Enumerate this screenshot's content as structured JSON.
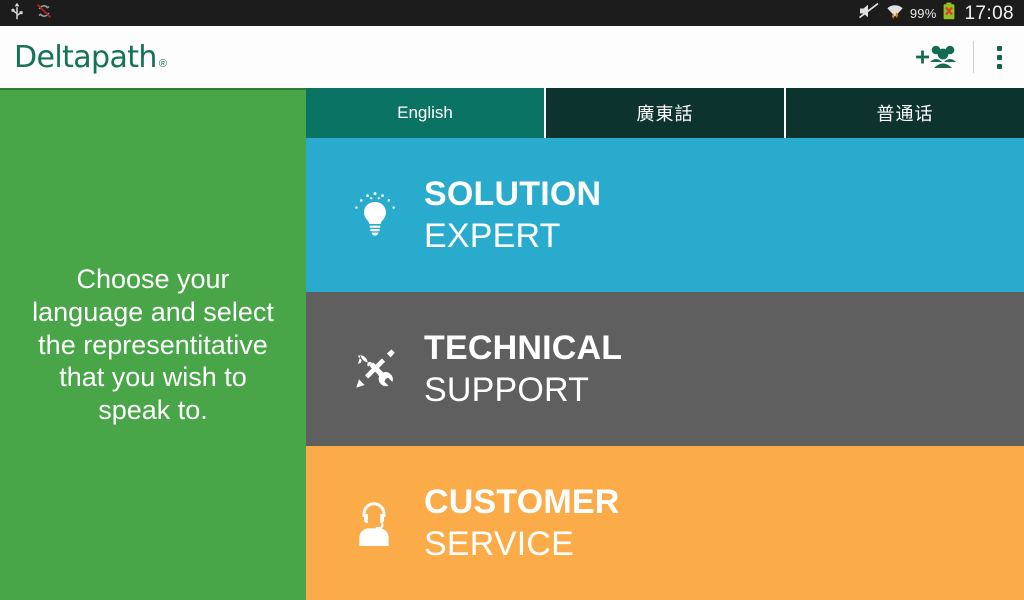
{
  "statusbar": {
    "left_icons": [
      {
        "name": "usb-icon",
        "label": "USB"
      },
      {
        "name": "sync-disabled-icon",
        "label": "Sync disabled"
      }
    ],
    "right": {
      "mute_icon": "volume-mute-icon",
      "wifi_icon": "wifi-icon",
      "battery_percent": "99%",
      "battery_icon": "battery-error-icon",
      "clock": "17:08"
    },
    "colors": {
      "background": "#1c1c1c",
      "text": "#f2f2f2",
      "battery_green": "#8fc31f",
      "battery_error": "#e03a2f"
    }
  },
  "appbar": {
    "logo_text": "Deltapath",
    "logo_registered": "®",
    "add_group_icon": "add-group-icon",
    "overflow_icon": "overflow-menu-icon",
    "colors": {
      "background": "#fdfdfd",
      "brand": "#127357"
    }
  },
  "sidepanel": {
    "instructions": "Choose your language and select the representitative that you wish to speak to.",
    "color": "#48a548"
  },
  "tabs": [
    {
      "label": "English",
      "lang": "en",
      "active": true,
      "color": "#0b7363"
    },
    {
      "label": "廣東話",
      "lang": "zh-Hant",
      "active": false,
      "color": "#0d332f"
    },
    {
      "label": "普通话",
      "lang": "zh-Hans",
      "active": false,
      "color": "#0d332f"
    }
  ],
  "options": [
    {
      "id": "solution-expert",
      "line1": "SOLUTION",
      "line2": "EXPERT",
      "icon": "lightbulb-icon",
      "color": "#29abcd"
    },
    {
      "id": "technical-support",
      "line1": "TECHNICAL",
      "line2": "SUPPORT",
      "icon": "tools-icon",
      "color": "#5f5f5f"
    },
    {
      "id": "customer-service",
      "line1": "CUSTOMER",
      "line2": "SERVICE",
      "icon": "headset-agent-icon",
      "color": "#fbab48"
    }
  ]
}
